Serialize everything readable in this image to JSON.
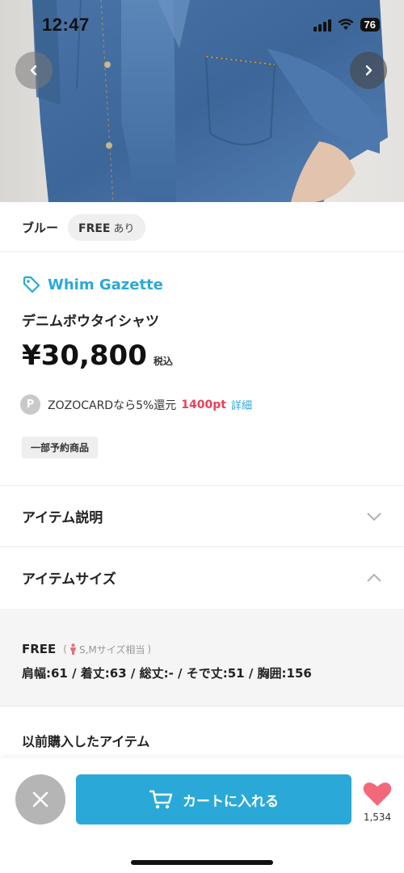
{
  "status_bar": {
    "time": "12:47",
    "battery": "76"
  },
  "product": {
    "color": "ブルー",
    "size": "FREE",
    "size_availability": "あり",
    "brand": "Whim Gazette",
    "name": "デニムボウタイシャツ",
    "price": "¥30,800",
    "tax_label": "税込",
    "points_badge": "P",
    "points_text": "ZOZOCARDなら5%還元",
    "points_value": "1400pt",
    "points_detail": "詳細",
    "preorder_tag": "一部予約商品"
  },
  "sections": {
    "description_label": "アイテム説明",
    "size_label": "アイテムサイズ",
    "size_name": "FREE",
    "size_equivalent": "S,Mサイズ相当",
    "size_equivalent_open": "(",
    "size_equivalent_close": ")",
    "size_dimensions": "肩幅:61 / 着丈:63 / 総丈:- / そで丈:51 / 胸囲:156",
    "previous_purchases_label": "以前購入したアイテム"
  },
  "bottom_bar": {
    "cart_label": "カートに入れる",
    "favorite_count": "1,534"
  },
  "colors": {
    "accent": "#2aa9d8",
    "points_red": "#e8415a",
    "close_gray": "#b5b5b5",
    "heart": "#f2697b"
  }
}
